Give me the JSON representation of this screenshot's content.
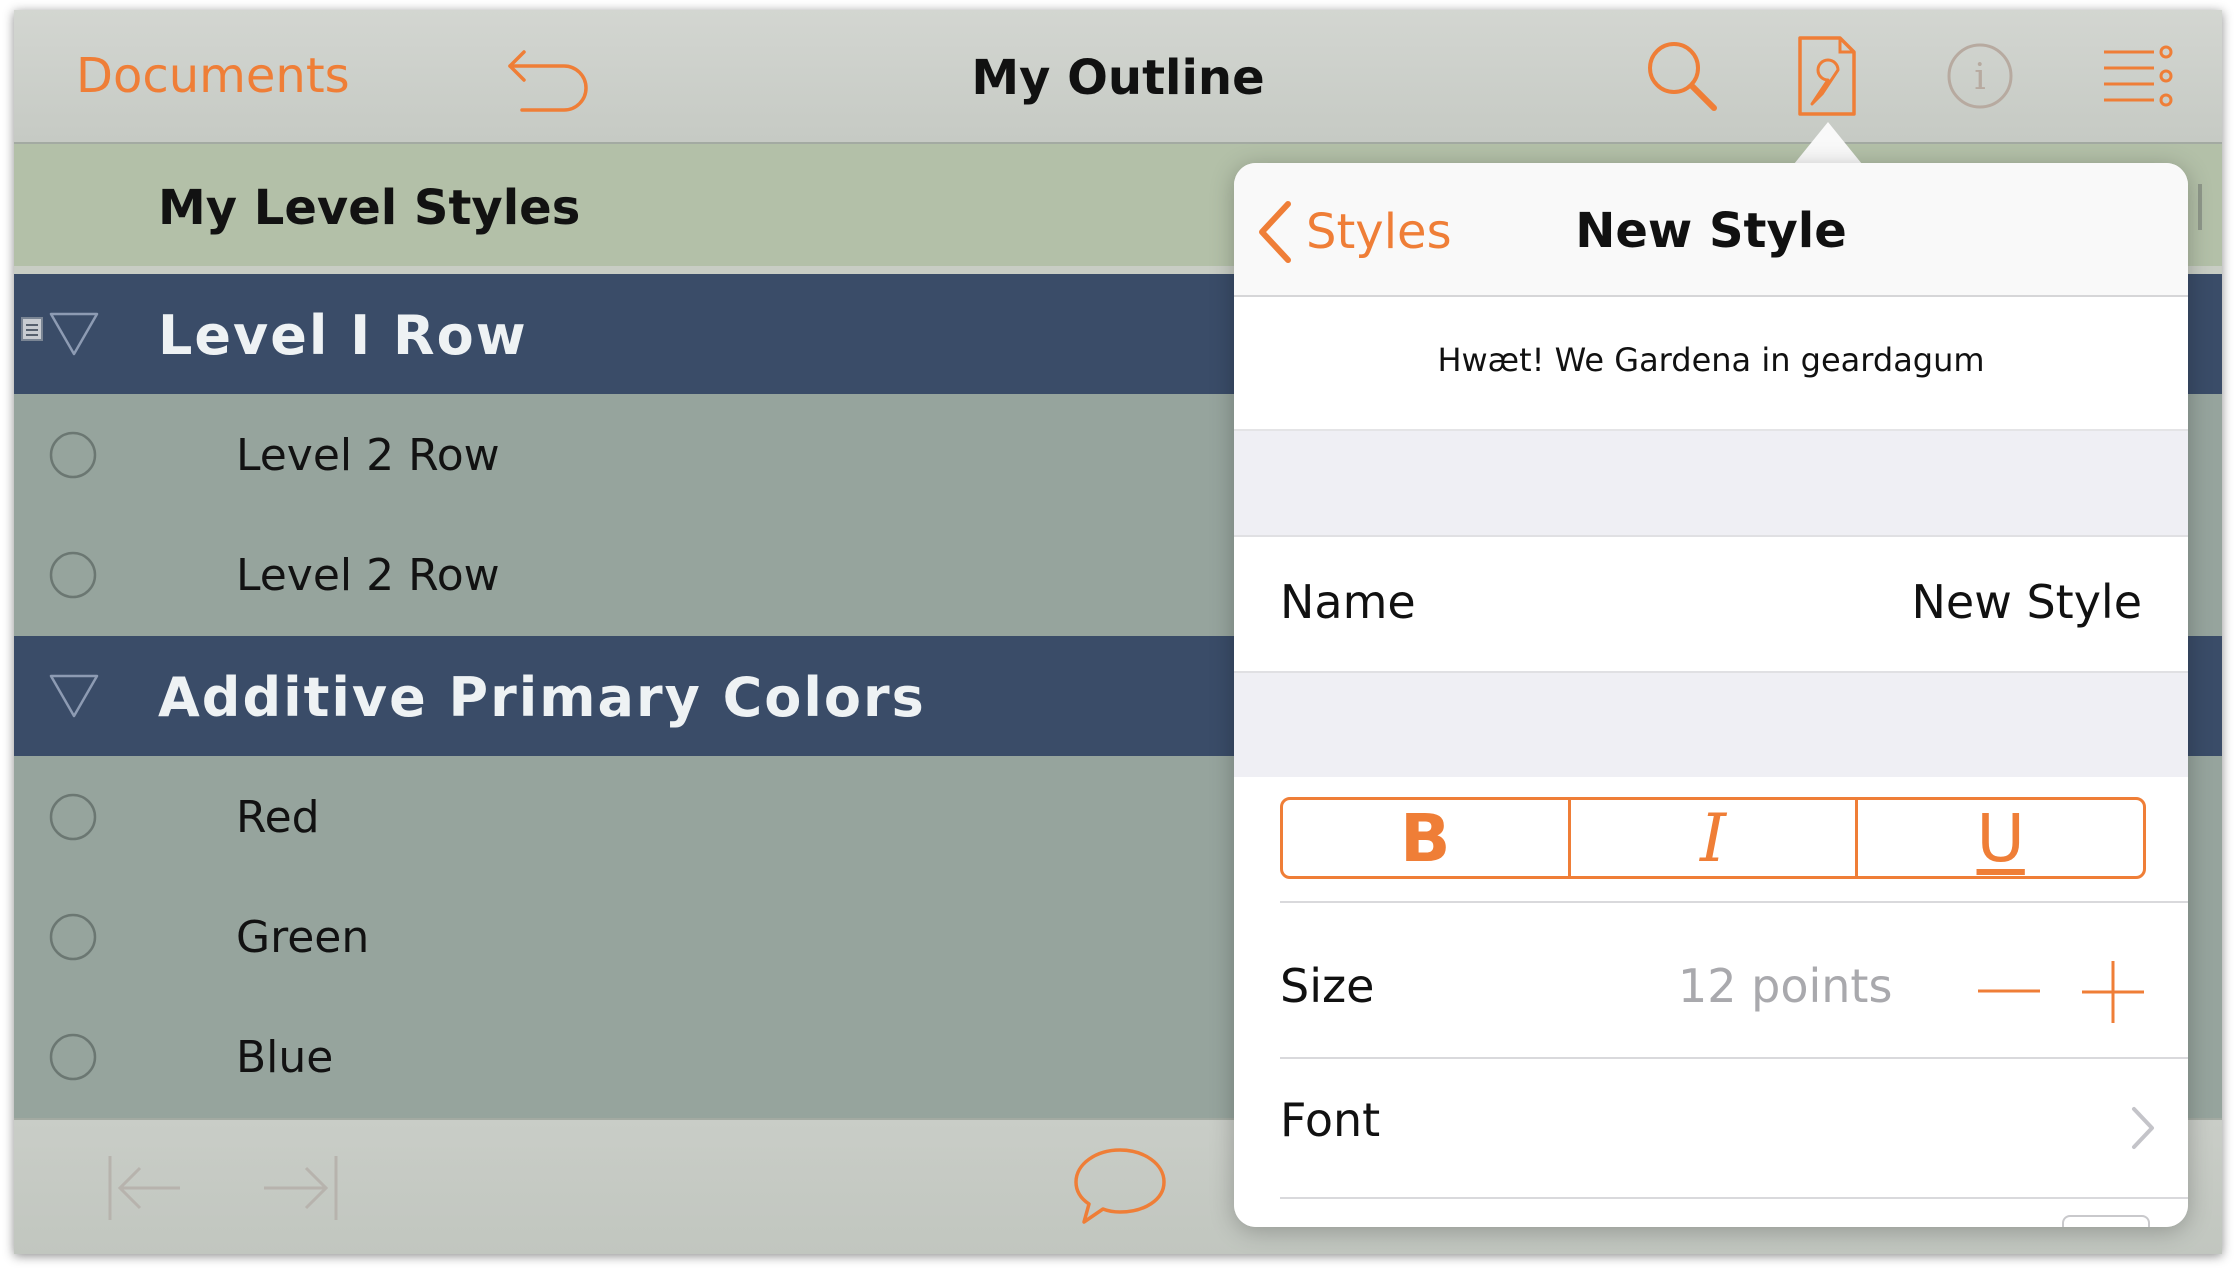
{
  "toolbar": {
    "documents_label": "Documents",
    "title": "My Outline",
    "icons": [
      "undo-icon",
      "search-icon",
      "style-icon",
      "info-icon",
      "outline-menu-icon"
    ]
  },
  "header": {
    "title": "My Level Styles"
  },
  "rows": [
    {
      "level": 1,
      "text": "Level I Row"
    },
    {
      "level": 2,
      "text": "Level 2 Row"
    },
    {
      "level": 2,
      "text": "Level 2 Row"
    },
    {
      "level": 1,
      "text": "Additive Primary Colors"
    },
    {
      "level": 2,
      "text": "Red"
    },
    {
      "level": 2,
      "text": "Green"
    },
    {
      "level": 2,
      "text": "Blue"
    }
  ],
  "popover": {
    "back_label": "Styles",
    "title": "New Style",
    "preview_text": "Hwæt! We Gardena in geardagum",
    "name_label": "Name",
    "name_value": "New Style",
    "bold_label": "B",
    "italic_label": "I",
    "underline_label": "U",
    "size_label": "Size",
    "size_value": "12 points",
    "font_label": "Font"
  },
  "colors": {
    "accent": "#ef7e37",
    "level1_row": "#3a4c68",
    "level2_row": "#96a49d",
    "header": "#b3c0a8"
  }
}
